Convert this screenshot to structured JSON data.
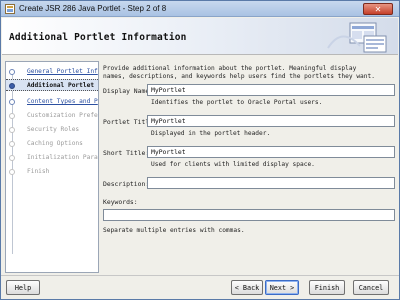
{
  "window": {
    "title": "Create JSR 286 Java Portlet - Step 2 of 8",
    "close_glyph": "✕"
  },
  "header": {
    "heading": "Additional Portlet Information"
  },
  "sidebar": {
    "steps": [
      {
        "label": "General Portlet Inf",
        "state": "done"
      },
      {
        "label": "Additional Portlet",
        "state": "active"
      },
      {
        "label": "Content Types and P",
        "state": "done"
      },
      {
        "label": "Customization Prefe",
        "state": "pending"
      },
      {
        "label": "Security Roles",
        "state": "pending"
      },
      {
        "label": "Caching Options",
        "state": "pending"
      },
      {
        "label": "Initialization Para",
        "state": "pending"
      },
      {
        "label": "Finish",
        "state": "pending"
      }
    ]
  },
  "main": {
    "intro_line1": "Provide additional information about the portlet. Meaningful display",
    "intro_line2": "names, descriptions, and keywords help users find the portlets they want.",
    "display_name": {
      "label": "Display Name:",
      "value": "MyPortlet",
      "hint": "Identifies the portlet to Oracle Portal users."
    },
    "portlet_title": {
      "label": "Portlet Title:",
      "value": "MyPortlet",
      "hint": "Displayed in the portlet header."
    },
    "short_title": {
      "label": "Short Title:",
      "value": "MyPortlet",
      "hint": "Used for clients with limited display space."
    },
    "description": {
      "label": "Description:",
      "value": ""
    },
    "keywords": {
      "label": "Keywords:",
      "value": "",
      "note": "Separate multiple entries with commas."
    }
  },
  "buttons": {
    "help": "Help",
    "back": "< Back",
    "next": "Next >",
    "finish": "Finish",
    "cancel": "Cancel"
  }
}
